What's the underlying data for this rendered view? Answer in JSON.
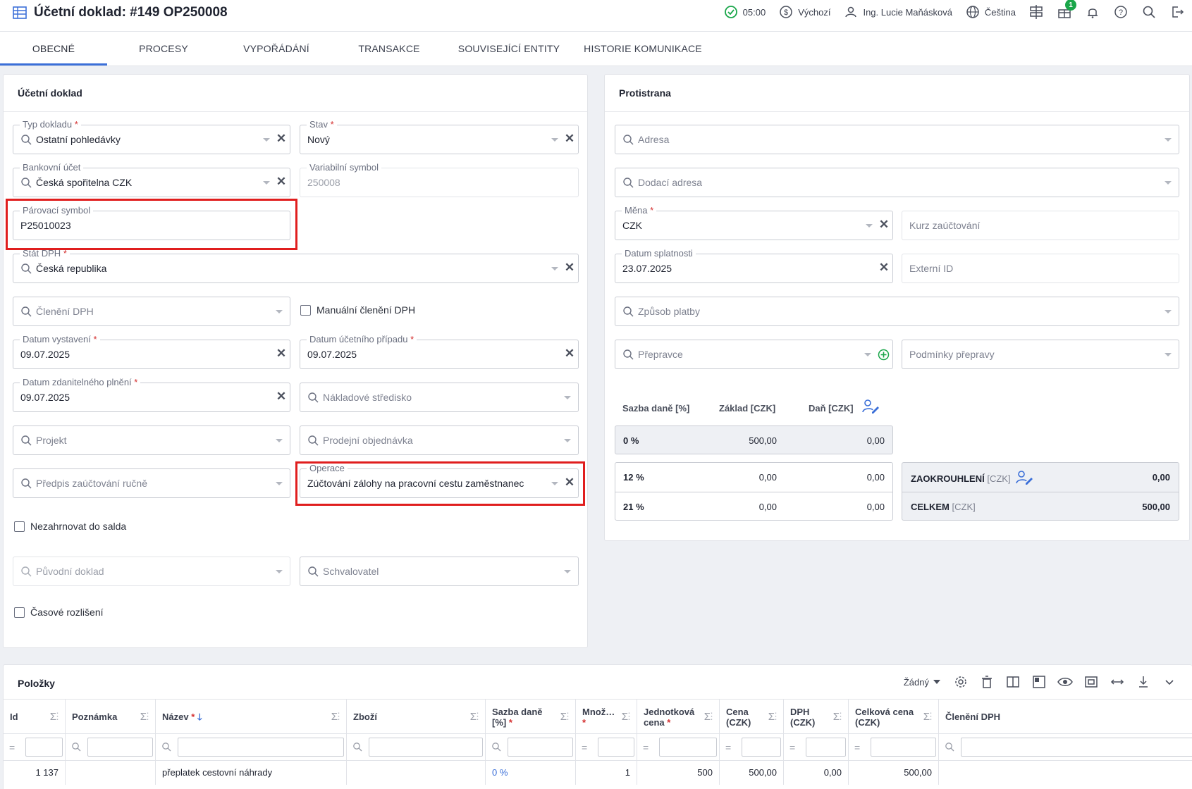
{
  "header": {
    "title": "Účetní doklad: #149 OP250008",
    "time": "05:00",
    "currency_profile": "Výchozí",
    "user": "Ing. Lucie Maňásková",
    "language": "Čeština",
    "gift_badge": "1"
  },
  "tabs": [
    "OBECNÉ",
    "PROCESY",
    "VYPOŘÁDÁNÍ",
    "TRANSAKCE",
    "SOUVISEJÍCÍ ENTITY",
    "HISTORIE KOMUNIKACE"
  ],
  "left_card": {
    "title": "Účetní doklad",
    "typ_dokladu": {
      "label": "Typ dokladu",
      "value": "Ostatní pohledávky"
    },
    "stav": {
      "label": "Stav",
      "value": "Nový"
    },
    "bankovni_ucet": {
      "label": "Bankovní účet",
      "value": "Česká spořitelna CZK"
    },
    "variabilni_symbol": {
      "label": "Variabilní symbol",
      "value": "250008"
    },
    "parovaci_symbol": {
      "label": "Párovací symbol",
      "value": "P25010023"
    },
    "stat_dph": {
      "label": "Stát DPH",
      "value": "Česká republika"
    },
    "cleneni_dph": {
      "placeholder": "Členění DPH"
    },
    "manualni_cleneni": {
      "label": "Manuální členění DPH"
    },
    "datum_vystaveni": {
      "label": "Datum vystavení",
      "value": "09.07.2025"
    },
    "datum_ucetniho_pripadu": {
      "label": "Datum účetního případu",
      "value": "09.07.2025"
    },
    "datum_zdanitelneho_plneni": {
      "label": "Datum zdanitelného plnění",
      "value": "09.07.2025"
    },
    "nakladove_stredisko": {
      "placeholder": "Nákladové středisko"
    },
    "projekt": {
      "placeholder": "Projekt"
    },
    "prodejni_objednavka": {
      "placeholder": "Prodejní objednávka"
    },
    "predpis_zauctovani": {
      "placeholder": "Předpis zaúčtování ručně"
    },
    "operace": {
      "label": "Operace",
      "value": "Zúčtování zálohy na pracovní cestu zaměstnanec"
    },
    "nezahrnovat": {
      "label": "Nezahrnovat do salda"
    },
    "puvodni_doklad": {
      "placeholder": "Původní doklad"
    },
    "schvalovatel": {
      "placeholder": "Schvalovatel"
    },
    "casove_rozliseni": {
      "label": "Časové rozlišení"
    }
  },
  "right_card": {
    "title": "Protistrana",
    "adresa": {
      "placeholder": "Adresa"
    },
    "dodaci_adresa": {
      "placeholder": "Dodací adresa"
    },
    "mena": {
      "label": "Měna",
      "value": "CZK"
    },
    "kurz": {
      "placeholder": "Kurz zaúčtování"
    },
    "datum_splatnosti": {
      "label": "Datum splatnosti",
      "value": "23.07.2025"
    },
    "externi_id": {
      "placeholder": "Externí ID"
    },
    "zpusob_platby": {
      "placeholder": "Způsob platby"
    },
    "prepravce": {
      "placeholder": "Přepravce"
    },
    "podminky_prepravy": {
      "placeholder": "Podmínky přepravy"
    },
    "vat_headers": {
      "rate": "Sazba daně [%]",
      "base": "Základ [CZK]",
      "tax": "Daň [CZK]"
    },
    "vat_rows": [
      {
        "rate": "0 %",
        "base": "500,00",
        "tax": "0,00"
      },
      {
        "rate": "12 %",
        "base": "0,00",
        "tax": "0,00"
      },
      {
        "rate": "21 %",
        "base": "0,00",
        "tax": "0,00"
      }
    ],
    "rounding": {
      "label": "ZAOKROUHLENÍ",
      "unit": "[CZK]",
      "value": "0,00"
    },
    "total": {
      "label": "CELKEM",
      "unit": "[CZK]",
      "value": "500,00"
    }
  },
  "items": {
    "title": "Položky",
    "view_select": "Žádný",
    "columns": [
      {
        "label": "Id"
      },
      {
        "label": "Poznámka"
      },
      {
        "label": "Název",
        "required": true
      },
      {
        "label": "Zboží"
      },
      {
        "label": "Sazba daně [%]",
        "required": true
      },
      {
        "label": "Množ…",
        "required": true
      },
      {
        "label": "Jednotková cena",
        "required": true
      },
      {
        "label": "Cena (CZK)"
      },
      {
        "label": "DPH (CZK)"
      },
      {
        "label": "Celková cena (CZK)"
      },
      {
        "label": "Členění DPH"
      }
    ],
    "rows": [
      {
        "id": "1 137",
        "poznamka": "",
        "nazev": "přeplatek cestovní náhrady",
        "zbozi": "",
        "sazba": "0 %",
        "mnozstvi": "1",
        "jednotkova_cena": "500",
        "cena": "500,00",
        "dph": "0,00",
        "celkova_cena": "500,00",
        "cleneni": ""
      }
    ]
  }
}
